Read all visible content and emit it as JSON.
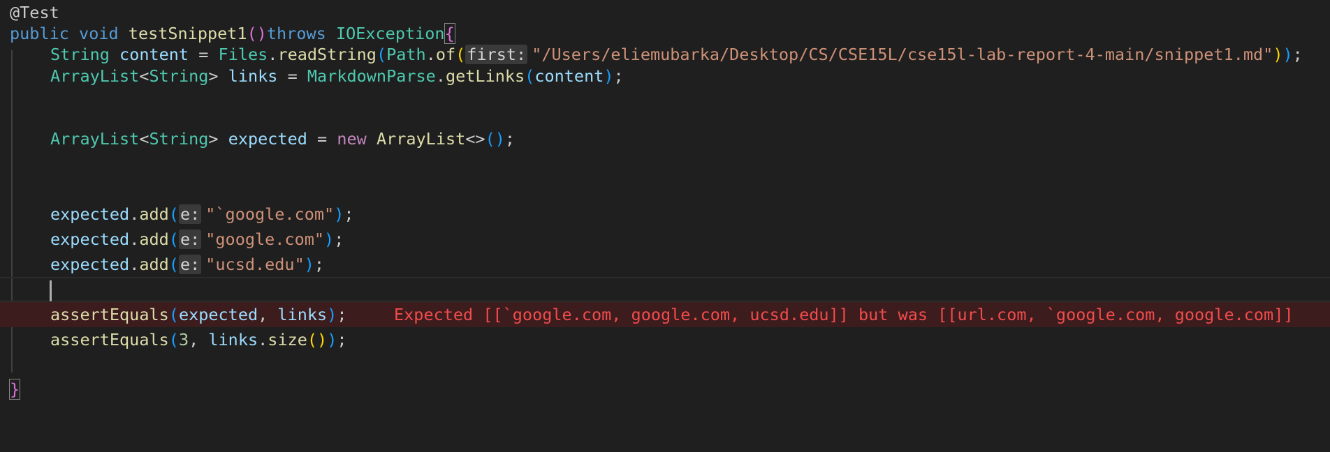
{
  "editor": {
    "lines": [
      {
        "tokens": [
          "@Test"
        ]
      },
      {
        "tokens": [
          "public",
          " ",
          "void",
          " ",
          "testSnippet1",
          "(",
          ")",
          "throws",
          " ",
          "IOException",
          "{"
        ]
      },
      {
        "tokens": [
          "String",
          " ",
          "content",
          " = ",
          "Files",
          ".",
          "readString",
          "(",
          "Path",
          ".",
          "of",
          "(",
          "first:",
          "\"/Users/eliemubarka/Desktop/CS/CSE15L/cse15l-lab-report-4-main/snippet1.md\"",
          ")",
          ")",
          ";"
        ]
      },
      {
        "tokens": [
          "ArrayList",
          "<",
          "String",
          "> ",
          "links",
          " = ",
          "MarkdownParse",
          ".",
          "getLinks",
          "(",
          "content",
          ")",
          ";"
        ]
      },
      {
        "tokens": [
          "ArrayList",
          "<",
          "String",
          "> ",
          "expected",
          " = ",
          "new",
          " ",
          "ArrayList",
          "<>",
          "(",
          ")",
          ";"
        ]
      },
      {
        "tokens": [
          "expected",
          ".",
          "add",
          "(",
          "e:",
          "\"`google.com\"",
          ")",
          ";"
        ]
      },
      {
        "tokens": [
          "expected",
          ".",
          "add",
          "(",
          "e:",
          "\"google.com\"",
          ")",
          ";"
        ]
      },
      {
        "tokens": [
          "expected",
          ".",
          "add",
          "(",
          "e:",
          "\"ucsd.edu\"",
          ")",
          ";"
        ]
      },
      {
        "tokens": [
          "assertEquals",
          "(",
          "expected",
          ", ",
          "links",
          ")",
          ";"
        ]
      },
      {
        "tokens": [
          "assertEquals",
          "(",
          "3",
          ", ",
          "links",
          ".",
          "size",
          "(",
          ")",
          ")",
          ";"
        ]
      },
      {
        "tokens": [
          "}"
        ]
      }
    ],
    "error_message": "Expected [[`google.com, google.com, ucsd.edu]] but was [[url.com, `google.com, google.com]]"
  },
  "colors": {
    "background": "#1f1f1f",
    "keyword": "#569cd6",
    "type": "#4ec9b0",
    "function": "#dcdcaa",
    "variable": "#9cdcfe",
    "string": "#ce9178",
    "error": "#f14c4c",
    "error_background": "#3d1c1e"
  }
}
